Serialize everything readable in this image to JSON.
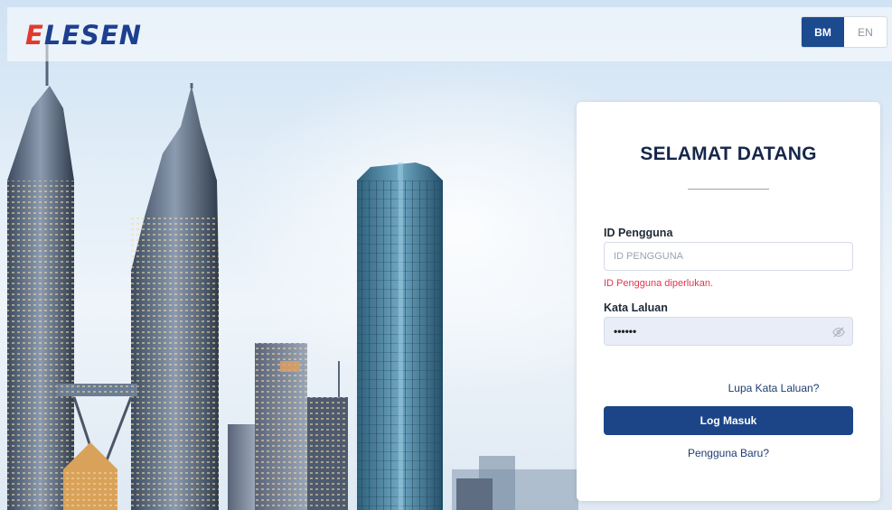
{
  "header": {
    "logo_first": "E",
    "logo_rest": "LESEN",
    "languages": [
      {
        "code": "BM",
        "active": true
      },
      {
        "code": "EN",
        "active": false
      }
    ]
  },
  "login": {
    "title": "SELAMAT DATANG",
    "user_label": "ID Pengguna",
    "user_placeholder": "ID PENGGUNA",
    "user_value": "",
    "user_error": "ID Pengguna diperlukan.",
    "pass_label": "Kata Laluan",
    "pass_value": "••••••",
    "forgot_link": "Lupa Kata Laluan?",
    "submit_label": "Log Masuk",
    "new_user_link": "Pengguna Baru?"
  },
  "colors": {
    "brand_blue": "#1b4587",
    "logo_red": "#e23a2f",
    "error_red": "#e0364f"
  },
  "icons": {
    "password_toggle": "eye-icon"
  }
}
